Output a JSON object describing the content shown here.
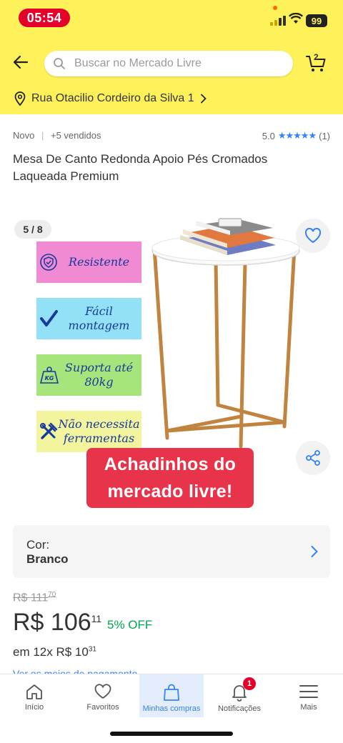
{
  "status_bar": {
    "time": "05:54",
    "battery": "99"
  },
  "header": {
    "search_placeholder": "Buscar no Mercado Livre",
    "cart_count": "2",
    "address": "Rua Otacilio Cordeiro da Silva 1"
  },
  "product": {
    "condition": "Novo",
    "separator": "|",
    "sold": "+5 vendidos",
    "rating": "5.0",
    "rating_stars": "★★★★★",
    "review_count": "(1)",
    "title": "Mesa De Canto Redonda Apoio Pés Cromados Laqueada Premium"
  },
  "gallery": {
    "position": "5 / 8",
    "features": [
      {
        "text": "Resistente"
      },
      {
        "text": "Fácil montagem"
      },
      {
        "text": "Suporta até 80kg"
      },
      {
        "text": "Não necessita ferramentas"
      }
    ],
    "promo_line1": "Achadinhos do",
    "promo_line2": "mercado livre!"
  },
  "variant": {
    "label": "Cor:",
    "value": "Branco"
  },
  "pricing": {
    "old_price": "R$ 111",
    "old_cents": "70",
    "price": "R$ 106",
    "price_cents": "11",
    "discount": "5% OFF",
    "installments": "em 12x R$ 10",
    "installment_cents": "31",
    "payment_link": "Ver os meios de pagamento"
  },
  "bottom_nav": {
    "items": [
      {
        "label": "Início"
      },
      {
        "label": "Favoritos"
      },
      {
        "label": "Minhas compras"
      },
      {
        "label": "Notificações"
      },
      {
        "label": "Mais"
      }
    ],
    "notification_badge": "1"
  },
  "colors": {
    "header_yellow": "#fff159",
    "accent_blue": "#3483fa",
    "discount_green": "#00a650",
    "promo_red": "#e8344a"
  }
}
